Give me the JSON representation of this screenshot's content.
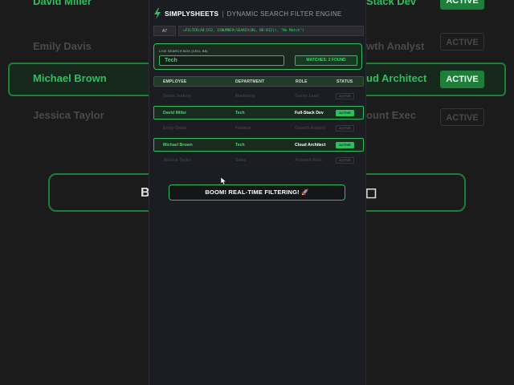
{
  "app": {
    "brand": "SIMPLYSHEETS",
    "separator": "|",
    "subtitle": "DYNAMIC SEARCH FILTER ENGINE"
  },
  "formula_bar": {
    "cell_ref": "A7",
    "formula": "=FILTER(A8:D12, ISNUMBER(SEARCH(B6, B8:B12)), \"No Match\")"
  },
  "search": {
    "label": "LIVE SEARCH BOX (CELL B6)",
    "value": "Tech",
    "matches": "MATCHES: 2 FOUND"
  },
  "table": {
    "headers": [
      "EMPLOYEE",
      "DEPARTMENT",
      "ROLE",
      "STATUS"
    ],
    "rows": [
      {
        "employee": "Sarah Jenkins",
        "department": "Marketing",
        "role": "Senior Lead",
        "status": "ACTIVE",
        "match": false
      },
      {
        "employee": "David Miller",
        "department": "Tech",
        "role": "Full-Stack Dev",
        "status": "ACTIVE",
        "match": true
      },
      {
        "employee": "Emily Davis",
        "department": "Finance",
        "role": "Growth Analyst",
        "status": "ACTIVE",
        "match": false
      },
      {
        "employee": "Michael Brown",
        "department": "Tech",
        "role": "Cloud Architect",
        "status": "ACTIVE",
        "match": true
      },
      {
        "employee": "Jessica Taylor",
        "department": "Sales",
        "role": "Account Exec",
        "status": "ACTIVE",
        "match": false
      }
    ]
  },
  "banner": "BOOM! REAL-TIME FILTERING! 🚀",
  "background": {
    "rows": [
      {
        "name": "David Miller",
        "role": "Stack Dev",
        "status": "ACTIVE"
      },
      {
        "name": "Emily Davis",
        "role": "wth Analyst",
        "status": "ACTIVE"
      },
      {
        "name": "Michael Brown",
        "role": "ud Architect",
        "status": "ACTIVE"
      },
      {
        "name": "Jessica Taylor",
        "role": "ount Exec",
        "status": "ACTIVE"
      }
    ],
    "banner_left": "B",
    "banner_right": "☐"
  },
  "colors": {
    "accent": "#2fbf5e",
    "accent_text": "#3fd96a",
    "panel_bg": "#1c1d22",
    "page_bg": "#1b1b1b"
  },
  "icons": {
    "brand": "lightning-bolt-icon",
    "cursor": "mouse-pointer-icon"
  }
}
